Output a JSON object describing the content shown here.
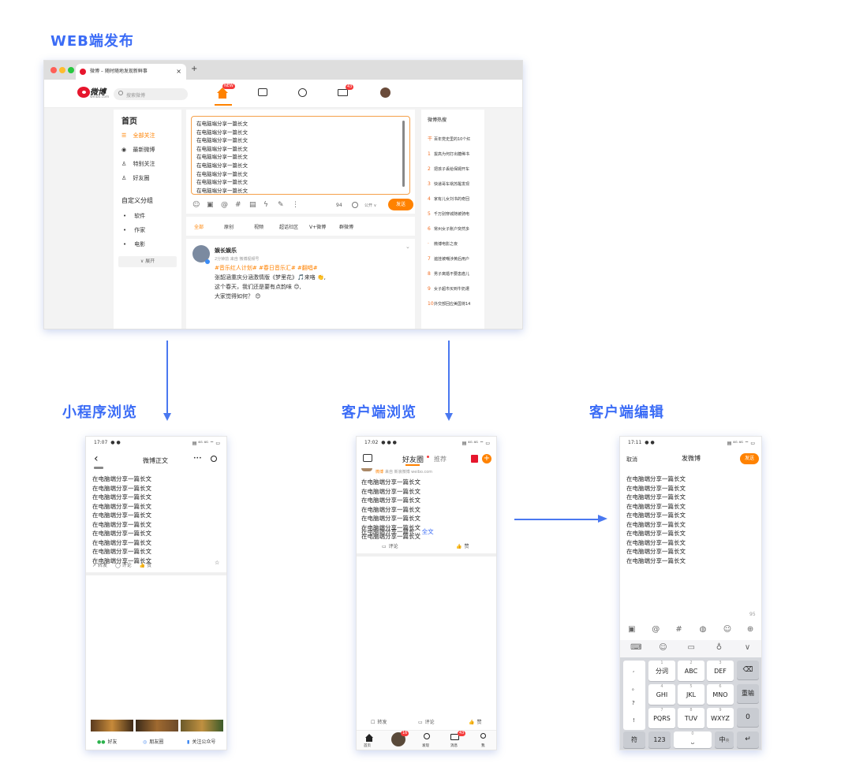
{
  "headings": {
    "web_publish": "WEB端发布",
    "mini_program_view": "小程序浏览",
    "client_view": "客户端浏览",
    "client_edit": "客户端编辑"
  },
  "colors": {
    "accent_blue": "#3b6cf6",
    "weibo_orange": "#ff8200",
    "badge_red": "#f53b3b"
  },
  "post_line": "在电脑端分享一篇长文",
  "web": {
    "tab_title": "微博 – 随时随地发现新鲜事",
    "tab_close": "×",
    "new_tab": "+",
    "logo_text": "微博",
    "logo_domain": "weibo.com",
    "search_placeholder": "搜索微博",
    "nav_badge_new": "NEW",
    "nav_badge_count": "43",
    "sidebar": {
      "title": "首页",
      "items": [
        {
          "icon": "list-icon",
          "label": "全部关注"
        },
        {
          "icon": "clock-icon",
          "label": "最新微博"
        },
        {
          "icon": "user-icon",
          "label": "特别关注"
        },
        {
          "icon": "users-icon",
          "label": "好友圈"
        }
      ],
      "group_title": "自定义分组",
      "groups": [
        "软件",
        "作家",
        "电影"
      ],
      "expand": "∨ 展开"
    },
    "editor": {
      "lines_visible": 9,
      "toolbar_icons": [
        "emoji-icon",
        "image-icon",
        "at-icon",
        "hash-icon",
        "calendar-icon",
        "lightning-icon",
        "edit-icon",
        "more-icon"
      ],
      "count": "94",
      "visibility": "公开 ∨",
      "send": "发送"
    },
    "feed_tabs": [
      "全部",
      "原创",
      "视频",
      "超话社区",
      "V+微博",
      "群微博"
    ],
    "post": {
      "author": "娱长娱乐",
      "meta": "2分钟前 来自 微博视频号",
      "tags": "#音乐红人计划# #春日音乐汇# #翻唱#",
      "line1": "张韶涵重庆分涵激情版《梦里花》🎵来咯 👏,",
      "line2": "这个春天，我们还是要有点韵味 😊,",
      "line3": "大家觉得如何？ 😊"
    },
    "hot": {
      "title": "微博热搜",
      "items": [
        {
          "rank": "干",
          "text": "百年党史里的10个红"
        },
        {
          "rank": "1",
          "text": "拔高为何打出糖稀书"
        },
        {
          "rank": "2",
          "text": "把孩子丢给保姆开车"
        },
        {
          "rank": "3",
          "text": "快递哥车祸苏醒发现"
        },
        {
          "rank": "4",
          "text": "家有儿女刘书的奇回"
        },
        {
          "rank": "5",
          "text": "千万别穿城随被骑电"
        },
        {
          "rank": "6",
          "text": "常州女子账户突然多"
        },
        {
          "rank": "·",
          "text": "微博电影之夜"
        },
        {
          "rank": "7",
          "text": "遍挂被嘲涉黄后用户"
        },
        {
          "rank": "8",
          "text": "男子离婚不要患癌儿"
        },
        {
          "rank": "9",
          "text": "女子超市买到牛奶遭"
        },
        {
          "rank": "10",
          "text": "外交部回应美国将14"
        }
      ]
    }
  },
  "mini": {
    "time": "17:07",
    "title": "微博正文",
    "back": "‹",
    "more": "•••",
    "lines_visible": 10,
    "actions": [
      "转发",
      "评论",
      "赞"
    ],
    "share": [
      "好友",
      "朋友圈",
      "关注公众号"
    ]
  },
  "client": {
    "time": "17:02",
    "tab_active": "好友圈",
    "tab_other": "推荐",
    "source": "来自 新浪微博 weibo.com",
    "source_tag": "微博",
    "lines_visible": 7,
    "last_line": "在电脑端分享一篇长...",
    "full_text": "全文",
    "comment": "评论",
    "like": "赞",
    "bottom_actions": [
      "转发",
      "评论",
      "赞"
    ],
    "nav": [
      "首页",
      "",
      "发现",
      "消息",
      "我"
    ],
    "nav_badge_home": "16",
    "nav_badge_msg": "43"
  },
  "edit": {
    "time": "17:11",
    "cancel": "取消",
    "title": "发微博",
    "send": "发送",
    "lines_visible": 10,
    "count": "95",
    "toolbar1": [
      "image-icon",
      "at-icon",
      "hash-icon",
      "gif-icon",
      "emoji-icon",
      "plus-icon"
    ],
    "toolbar2": [
      "keyboard-icon",
      "smile-icon",
      "clipboard-icon",
      "mic-icon",
      "chevron-down-icon"
    ],
    "keys": {
      "row1": [
        {
          "n": "1",
          "l": "分词"
        },
        {
          "n": "2",
          "l": "ABC"
        },
        {
          "n": "3",
          "l": "DEF"
        }
      ],
      "row2": [
        {
          "n": "4",
          "l": "GHI"
        },
        {
          "n": "5",
          "l": "JKL"
        },
        {
          "n": "6",
          "l": "MNO"
        }
      ],
      "row3": [
        {
          "n": "7",
          "l": "PQRS"
        },
        {
          "n": "8",
          "l": "TUV"
        },
        {
          "n": "9",
          "l": "WXYZ"
        }
      ],
      "left": [
        ",",
        "。",
        "?",
        "!"
      ],
      "backspace": "⌫",
      "reenter": "重输",
      "zero": "0",
      "symbol": "符",
      "num": "123",
      "space_num": "0",
      "lang": "中",
      "lang_sub": "英",
      "enter": "↵"
    }
  }
}
